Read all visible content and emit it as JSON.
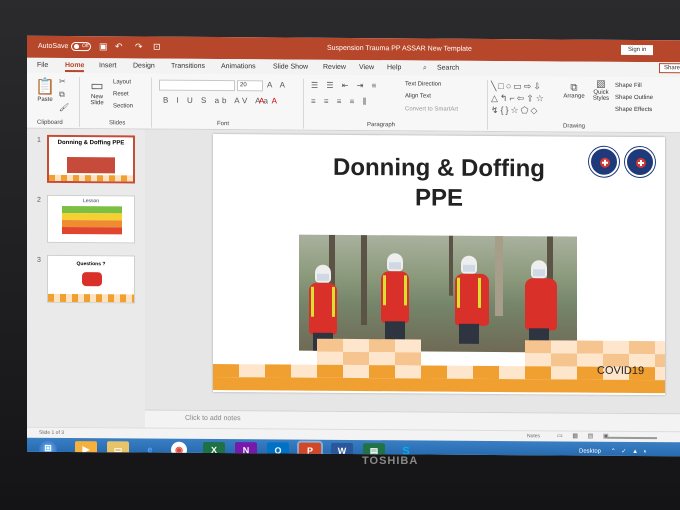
{
  "titlebar": {
    "autosave": "AutoSave",
    "toggle": "Off",
    "doc_title": "Suspension Trauma PP ASSAR New Template",
    "signin": "Sign in"
  },
  "tabs": [
    {
      "label": "File"
    },
    {
      "label": "Home"
    },
    {
      "label": "Insert"
    },
    {
      "label": "Design"
    },
    {
      "label": "Transitions"
    },
    {
      "label": "Animations"
    },
    {
      "label": "Slide Show"
    },
    {
      "label": "Review"
    },
    {
      "label": "View"
    },
    {
      "label": "Help"
    }
  ],
  "search": "Search",
  "share": "Share",
  "ribbon": {
    "paste": "Paste",
    "new_slide": "New Slide",
    "layout": "Layout",
    "reset": "Reset",
    "section": "Section",
    "font_size": "20",
    "text_direction": "Text Direction",
    "align_text": "Align Text",
    "smartart": "Convert to SmartArt",
    "arrange": "Arrange",
    "quick_styles": "Quick Styles",
    "shape_fill": "Shape Fill",
    "shape_outline": "Shape Outline",
    "shape_effects": "Shape Effects",
    "groups": {
      "clipboard": "Clipboard",
      "slides": "Slides",
      "font": "Font",
      "paragraph": "Paragraph",
      "drawing": "Drawing"
    }
  },
  "thumbnails": [
    {
      "num": "1",
      "title": "Donning & Doffing PPE"
    },
    {
      "num": "2",
      "title": "Lesson"
    },
    {
      "num": "3",
      "title": "Questions ?"
    }
  ],
  "slide": {
    "title_line1": "Donning & Doffing",
    "title_line2": "PPE",
    "footer": "COVID19"
  },
  "notes_placeholder": "Click to add notes",
  "status": {
    "slide_count": "Slide 1 of 3",
    "notes": "Notes"
  },
  "taskbar": {
    "desktop": "Desktop"
  },
  "brand": "TOSHIBA",
  "colors": {
    "accent": "#b7472a",
    "slide_orange": "#f0a030",
    "vest": "#d8e030"
  }
}
